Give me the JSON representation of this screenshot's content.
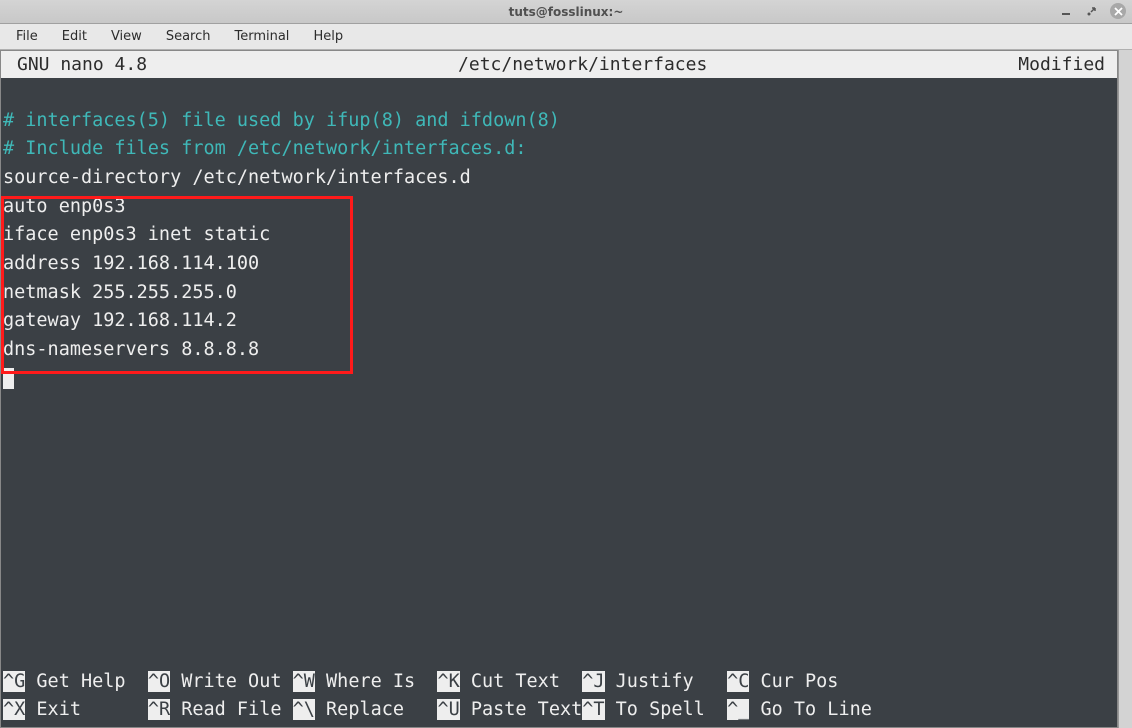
{
  "window": {
    "title": "tuts@fosslinux:~"
  },
  "menu": {
    "file": "File",
    "edit": "Edit",
    "view": "View",
    "search": "Search",
    "terminal": "Terminal",
    "help": "Help"
  },
  "nano": {
    "appname": "  GNU nano 4.8",
    "filename": "/etc/network/interfaces",
    "status": "Modified "
  },
  "content": {
    "comment1": "# interfaces(5) file used by ifup(8) and ifdown(8)",
    "comment2": "# Include files from /etc/network/interfaces.d:",
    "line3": "source-directory /etc/network/interfaces.d",
    "blank": "",
    "cfg1": "auto enp0s3",
    "cfg2": "iface enp0s3 inet static",
    "cfg3": "address 192.168.114.100",
    "cfg4": "netmask 255.255.255.0",
    "cfg5": "gateway 192.168.114.2",
    "cfg6": "dns-nameservers 8.8.8.8"
  },
  "shortcuts": {
    "g_key": "^G",
    "g_label": " Get Help  ",
    "o_key": "^O",
    "o_label": " Write Out ",
    "w_key": "^W",
    "w_label": " Where Is  ",
    "k_key": "^K",
    "k_label": " Cut Text  ",
    "j_key": "^J",
    "j_label": " Justify   ",
    "c_key": "^C",
    "c_label": " Cur Pos   ",
    "x_key": "^X",
    "x_label": " Exit      ",
    "r_key": "^R",
    "r_label": " Read File ",
    "bs_key": "^\\",
    "bs_label": " Replace   ",
    "u_key": "^U",
    "u_label": " Paste Text",
    "t_key": "^T",
    "t_label": " To Spell  ",
    "ul_key": "^_",
    "ul_label": " Go To Line"
  }
}
